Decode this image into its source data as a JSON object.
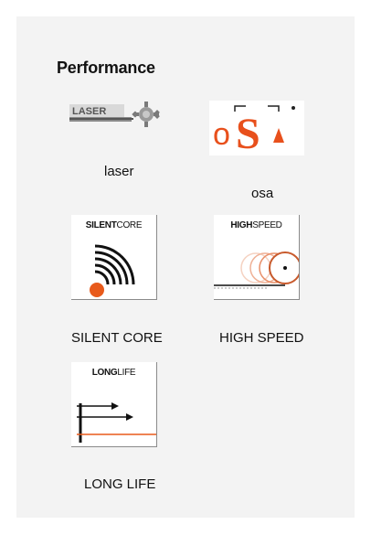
{
  "section": {
    "title": "Performance"
  },
  "features": [
    {
      "label": "laser",
      "icon": "laser-logo",
      "badge_text": "LASER"
    },
    {
      "label": "osa",
      "icon": "osa-logo",
      "badge_text": "oSA"
    },
    {
      "label": "SILENT CORE",
      "icon": "silent-core-icon",
      "head_bold": "SILENT",
      "head_light": "CORE"
    },
    {
      "label": "HIGH SPEED",
      "icon": "high-speed-icon",
      "head_bold": "HIGH",
      "head_light": "SPEED"
    },
    {
      "label": "LONG LIFE",
      "icon": "long-life-icon",
      "head_bold": "LONG",
      "head_light": "LIFE"
    }
  ],
  "colors": {
    "accent": "#e85a1b",
    "osa_red": "#e8501c",
    "panel_bg": "#f3f3f3"
  }
}
